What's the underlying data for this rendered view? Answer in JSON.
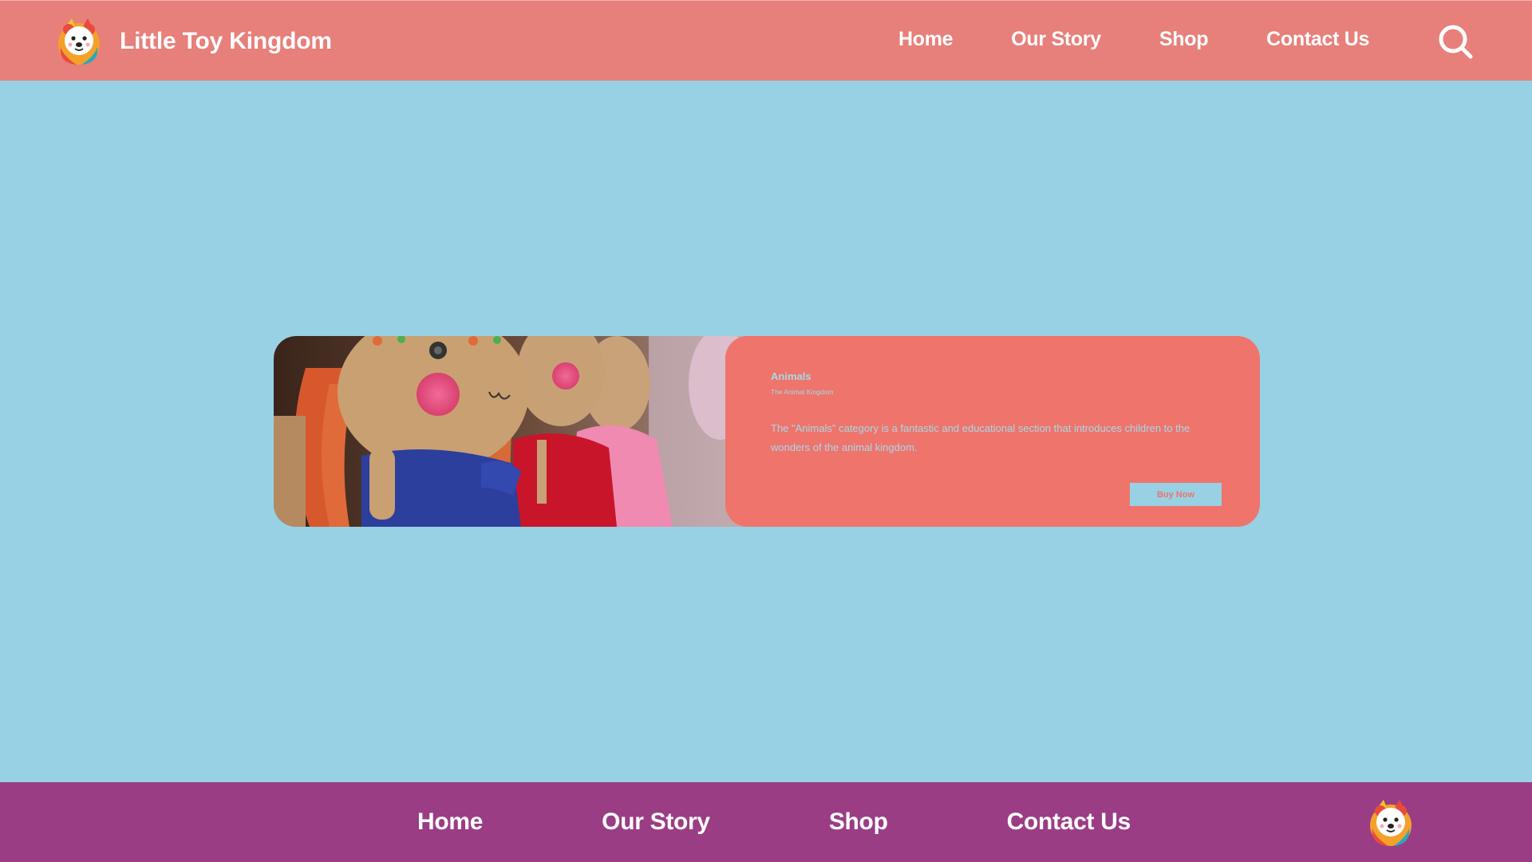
{
  "header": {
    "brand_name": "Little Toy Kingdom",
    "logo_icon": "bear-mascot-logo-icon",
    "nav": [
      {
        "label": "Home"
      },
      {
        "label": "Our Story"
      },
      {
        "label": "Shop"
      },
      {
        "label": "Contact Us"
      }
    ],
    "search_icon": "search-icon"
  },
  "card": {
    "image": "crocheted-dolls-photo",
    "title": "Animals",
    "subtitle": "The Animal Kingdom",
    "description": "The \"Animals\" category is a fantastic and educational section that introduces children to the wonders of the animal kingdom.",
    "button_label": "Buy Now"
  },
  "footer": {
    "nav": [
      {
        "label": "Home"
      },
      {
        "label": "Our Story"
      },
      {
        "label": "Shop"
      },
      {
        "label": "Contact Us"
      }
    ],
    "logo_icon": "bear-mascot-logo-icon"
  },
  "colors": {
    "page_background": "#98d1e3",
    "header_background": "#e77f7a",
    "card_panel": "#ee746c",
    "footer_background": "#9a3d85",
    "text_light": "#ffffff"
  }
}
